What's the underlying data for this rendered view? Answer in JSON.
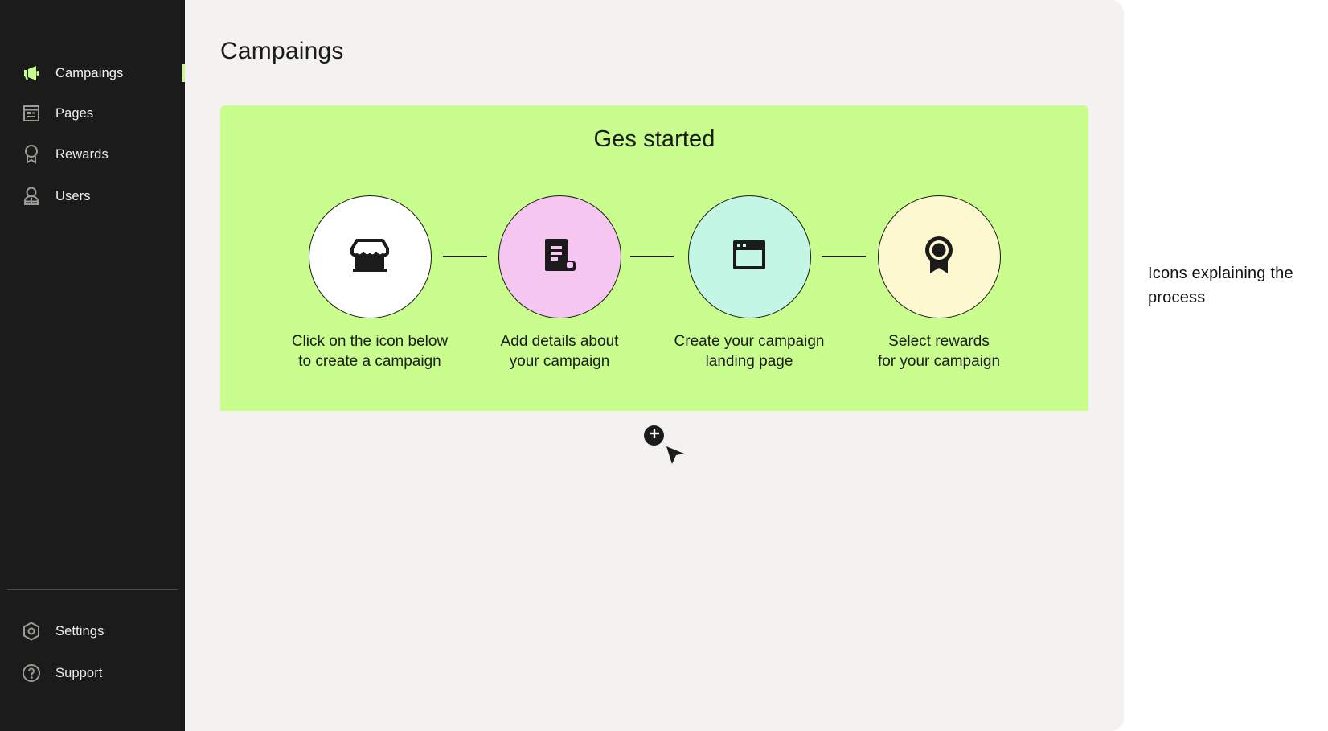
{
  "sidebar": {
    "items": [
      {
        "label": "Campaings",
        "icon": "megaphone-icon",
        "active": true
      },
      {
        "label": "Pages",
        "icon": "page-layout-icon",
        "active": false
      },
      {
        "label": "Rewards",
        "icon": "award-ribbon-icon",
        "active": false
      },
      {
        "label": "Users",
        "icon": "user-icon",
        "active": false
      }
    ],
    "footer_items": [
      {
        "label": "Settings",
        "icon": "settings-hex-icon"
      },
      {
        "label": "Support",
        "icon": "help-circle-icon"
      }
    ]
  },
  "main": {
    "title": "Campaings",
    "banner": {
      "title": "Ges started",
      "steps": [
        {
          "label": "Click on the icon below\nto create a campaign",
          "icon": "storefront-icon",
          "color": "#ffffff"
        },
        {
          "label": "Add details about\nyour campaign",
          "icon": "document-icon",
          "color": "#f5c7f0"
        },
        {
          "label": "Create your campaign\nlanding page",
          "icon": "browser-window-icon",
          "color": "#c3f6e4"
        },
        {
          "label": "Select rewards\nfor your campaign",
          "icon": "award-ribbon-icon",
          "color": "#fef8d0"
        }
      ]
    },
    "add_button_icon": "plus-circle-icon"
  },
  "annotation": {
    "text": "Icons explaining the process"
  },
  "colors": {
    "sidebar_bg": "#1b1b1b",
    "accent": "#c6fd8c",
    "main_bg": "#f3f2f0",
    "banner_bg": "#c9fd8d",
    "sidebar_icon": "#9a9c93"
  }
}
